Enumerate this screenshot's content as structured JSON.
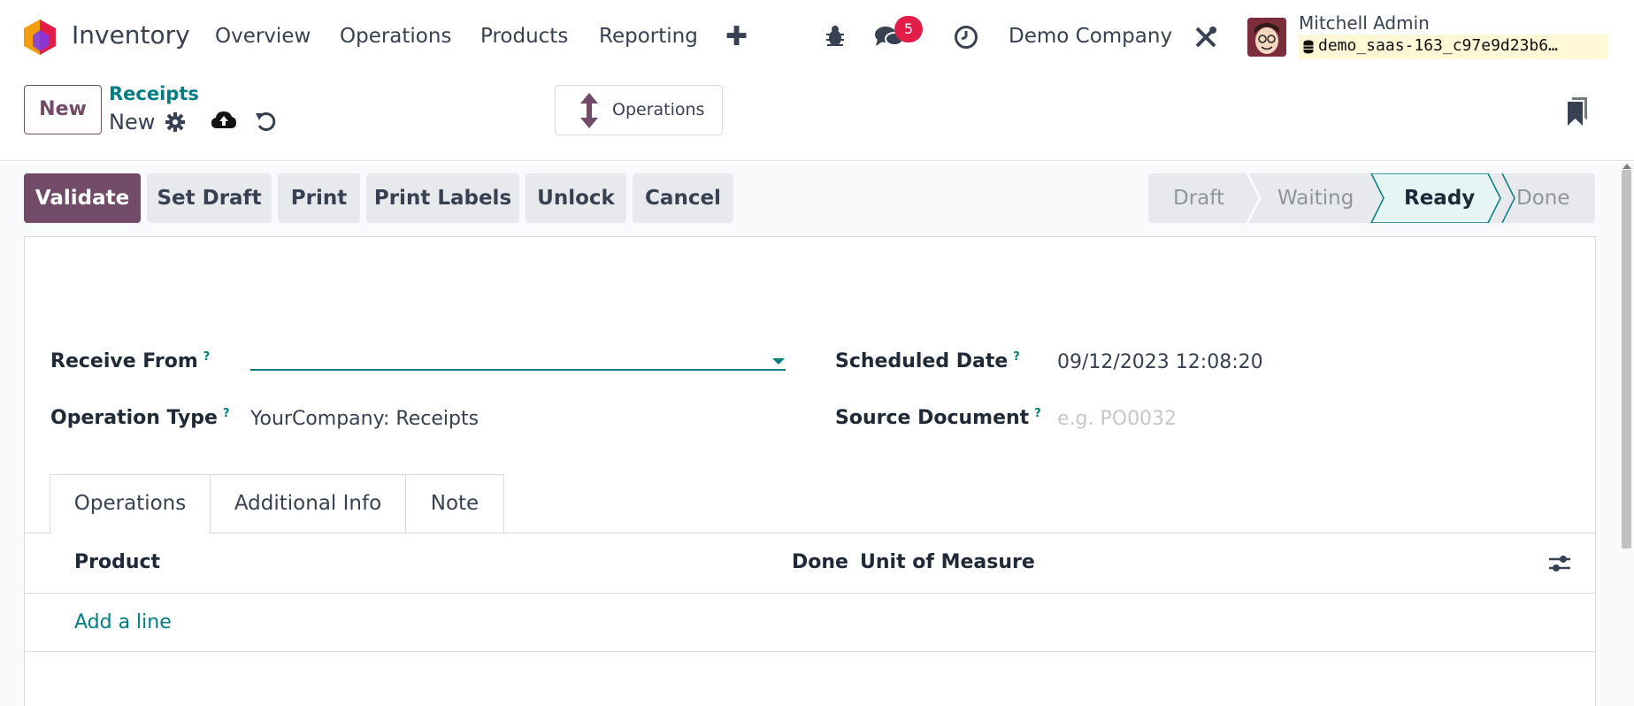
{
  "navbar": {
    "app_name": "Inventory",
    "menu": [
      "Overview",
      "Operations",
      "Products",
      "Reporting"
    ],
    "messages_badge": "5",
    "company": "Demo Company",
    "user_name": "Mitchell Admin",
    "database": "demo_saas-163_c97e9d23b6…"
  },
  "control": {
    "new_label": "New",
    "breadcrumb_parent": "Receipts",
    "breadcrumb_current": "New",
    "operations_label": "Operations"
  },
  "actions": {
    "validate": "Validate",
    "set_draft": "Set Draft",
    "print": "Print",
    "print_labels": "Print Labels",
    "unlock": "Unlock",
    "cancel": "Cancel"
  },
  "status": {
    "stages": [
      "Draft",
      "Waiting",
      "Ready",
      "Done"
    ],
    "current": "Ready"
  },
  "form": {
    "receive_from_label": "Receive From",
    "receive_from_value": "",
    "operation_type_label": "Operation Type",
    "operation_type_value": "YourCompany: Receipts",
    "scheduled_date_label": "Scheduled Date",
    "scheduled_date_value": "09/12/2023 12:08:20",
    "source_document_label": "Source Document",
    "source_document_placeholder": "e.g. PO0032",
    "help_mark": "?"
  },
  "tabs": [
    "Operations",
    "Additional Info",
    "Note"
  ],
  "table": {
    "columns": [
      "Product",
      "Done",
      "Unit of Measure"
    ],
    "add_line": "Add a line"
  },
  "colors": {
    "primary": "#714b67",
    "accent": "#017e84",
    "badge": "#e11d48"
  }
}
